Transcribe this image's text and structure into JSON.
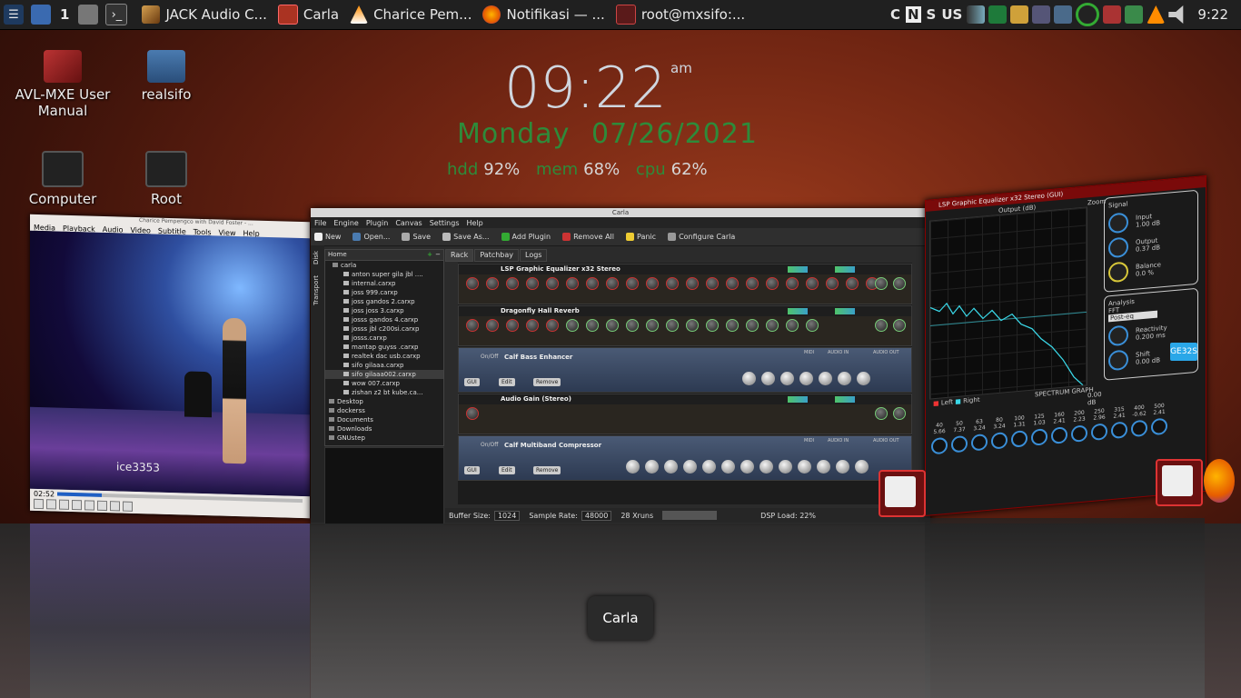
{
  "taskbar": {
    "workspace": "1",
    "tasks": [
      {
        "label": "JACK Audio C...",
        "icon": "jack-icon"
      },
      {
        "label": "Carla",
        "icon": "carla-icon"
      },
      {
        "label": "Charice Pem...",
        "icon": "vlc-icon"
      },
      {
        "label": "Notifikasi — ...",
        "icon": "firefox-icon"
      },
      {
        "label": "root@mxsifo:...",
        "icon": "terminal-icon"
      }
    ],
    "keyboard": [
      "C",
      "N",
      "S",
      "US"
    ],
    "clock": "9:22"
  },
  "desktop_icons": [
    {
      "label": "AVL-MXE User Manual"
    },
    {
      "label": "realsifo"
    },
    {
      "label": "Computer"
    },
    {
      "label": "Root"
    }
  ],
  "conky": {
    "time": "09:22",
    "ampm": "am",
    "day": "Monday",
    "date": "07/26/2021",
    "hdd_label": "hdd",
    "hdd_value": "92%",
    "mem_label": "mem",
    "mem_value": "68%",
    "cpu_label": "cpu",
    "cpu_value": "62%"
  },
  "vlc": {
    "title": "Charice Pempengco with David Foster - ...",
    "menu": [
      "Media",
      "Playback",
      "Audio",
      "Video",
      "Subtitle",
      "Tools",
      "View",
      "Help"
    ],
    "elapsed": "02:52",
    "watermark": "ice3353",
    "progress": 0.18
  },
  "carla": {
    "title": "Carla",
    "menu": [
      "File",
      "Engine",
      "Plugin",
      "Canvas",
      "Settings",
      "Help"
    ],
    "toolbar": [
      "New",
      "Open...",
      "Save",
      "Save As...",
      "Add Plugin",
      "Remove All",
      "Panic",
      "Configure Carla"
    ],
    "side_tabs": [
      "Disk",
      "Transport"
    ],
    "file_root": "Home",
    "file_tree": [
      {
        "name": "carla",
        "type": "folder"
      },
      {
        "name": "anton super gila jbl ....",
        "type": "file"
      },
      {
        "name": "internal.carxp",
        "type": "file"
      },
      {
        "name": "joss 999.carxp",
        "type": "file"
      },
      {
        "name": "joss gandos 2.carxp",
        "type": "file"
      },
      {
        "name": "joss joss 3.carxp",
        "type": "file"
      },
      {
        "name": "josss gandos 4.carxp",
        "type": "file"
      },
      {
        "name": "josss jbl c200si.carxp",
        "type": "file"
      },
      {
        "name": "josss.carxp",
        "type": "file"
      },
      {
        "name": "mantap guyss .carxp",
        "type": "file"
      },
      {
        "name": "realtek dac usb.carxp",
        "type": "file"
      },
      {
        "name": "sifo gilaaa.carxp",
        "type": "file"
      },
      {
        "name": "sifo gilaaa002.carxp",
        "type": "file",
        "selected": true
      },
      {
        "name": "wow 007.carxp",
        "type": "file"
      },
      {
        "name": "zishan z2 bt kube.ca...",
        "type": "file"
      },
      {
        "name": "Desktop",
        "type": "folder"
      },
      {
        "name": "dockerss",
        "type": "folder"
      },
      {
        "name": "Documents",
        "type": "folder"
      },
      {
        "name": "Downloads",
        "type": "folder"
      },
      {
        "name": "GNUstep",
        "type": "folder"
      }
    ],
    "rack_tabs": [
      "Rack",
      "Patchbay",
      "Logs"
    ],
    "plugins": [
      {
        "name": "LSP Graphic Equalizer x32 Stereo",
        "kind": "knobs",
        "params": [
          "In gain",
          "Ot gn",
          "Flt st",
          "FFT rst",
          "Sift gn",
          "Grph ms",
          "Ot bloc",
          "Bnd gn",
          "Bnd gn",
          "Bnd gn",
          "Bnd gn",
          "Bnd gn",
          "Bnd gn",
          "Bnd gn",
          "Bnd gn",
          "Bnd gn",
          "Bnd gn",
          "Bnd gn",
          "Bnd gn",
          "Bnd gn",
          "Bnd gn"
        ]
      },
      {
        "name": "Dragonfly Hall Reverb",
        "kind": "knobs",
        "params": [
          "Dry",
          "Early",
          "Late",
          "Size",
          "Width",
          "Pdly",
          "Diffuse",
          "LowCut",
          "LoCrs",
          "LowMult",
          "HighCut",
          "HighCrs",
          "HighMlt",
          "Spin",
          "Wander",
          "Decay",
          "EarlySnd",
          "Modln"
        ]
      },
      {
        "name": "Calf Bass Enhancer",
        "kind": "calf",
        "params": [
          "In",
          "Out",
          "Amount",
          "Hrmncs",
          "Blnd/Hrm",
          "Scope",
          "Floor"
        ]
      },
      {
        "name": "Audio Gain (Stereo)",
        "kind": "knobs",
        "params": [
          "Gain"
        ]
      },
      {
        "name": "Calf Multiband Compressor",
        "kind": "calf",
        "params": [
          "InGain",
          "OutGain",
          "Split1",
          "Split2",
          "Split3",
          "Thres1",
          "Ratio1",
          "Att1",
          "Rls1",
          "Mkup1",
          "Knee1",
          "Thres2",
          "Ratio2"
        ]
      }
    ],
    "dry_wet_label": "Dry/Wet",
    "volume_label": "Volume",
    "onoff_label": "On/Off",
    "calf_buttons": [
      "GUI",
      "Edit",
      "Remove"
    ],
    "calf_io": [
      "MIDI",
      "AUDIO IN",
      "AUDIO OUT"
    ],
    "status": {
      "buffer_label": "Buffer Size:",
      "buffer_value": "1024",
      "rate_label": "Sample Rate:",
      "rate_value": "48000",
      "xruns": "28 Xruns",
      "dsp_load": "DSP Load: 22%"
    }
  },
  "eq": {
    "title": "LSP Graphic Equalizer x32 Stereo (GUI)",
    "output_label": "Output (dB)",
    "zoom_label": "Zoom",
    "signal_label": "Signal",
    "input_label": "Input",
    "input_value": "1.00 dB",
    "output_value_label": "Output",
    "output_value": "0.37 dB",
    "balance_label": "Balance",
    "balance_value": "0.0 %",
    "analysis_label": "Analysis",
    "fft_label": "FFT",
    "fft_mode": "Post-eq",
    "reactivity_label": "Reactivity",
    "reactivity_value": "0.200 ms",
    "shift_label": "Shift",
    "shift_value": "0.00 dB",
    "spectrum_label": "SPECTRUM GRAPH",
    "left_label": "Left",
    "right_label": "Right",
    "db_label": "0.00 dB",
    "freq_labels": [
      "40",
      "50",
      "63",
      "80",
      "100",
      "125",
      "160",
      "200",
      "250",
      "315",
      "400",
      "500"
    ],
    "gains": [
      "5.66",
      "7.37",
      "3.24",
      "3.24",
      "1.31",
      "1.03",
      "2.41",
      "2.23",
      "2.96",
      "2.41",
      "-0.62",
      "2.41"
    ],
    "badge": "GE32S"
  },
  "tooltip": "Carla"
}
